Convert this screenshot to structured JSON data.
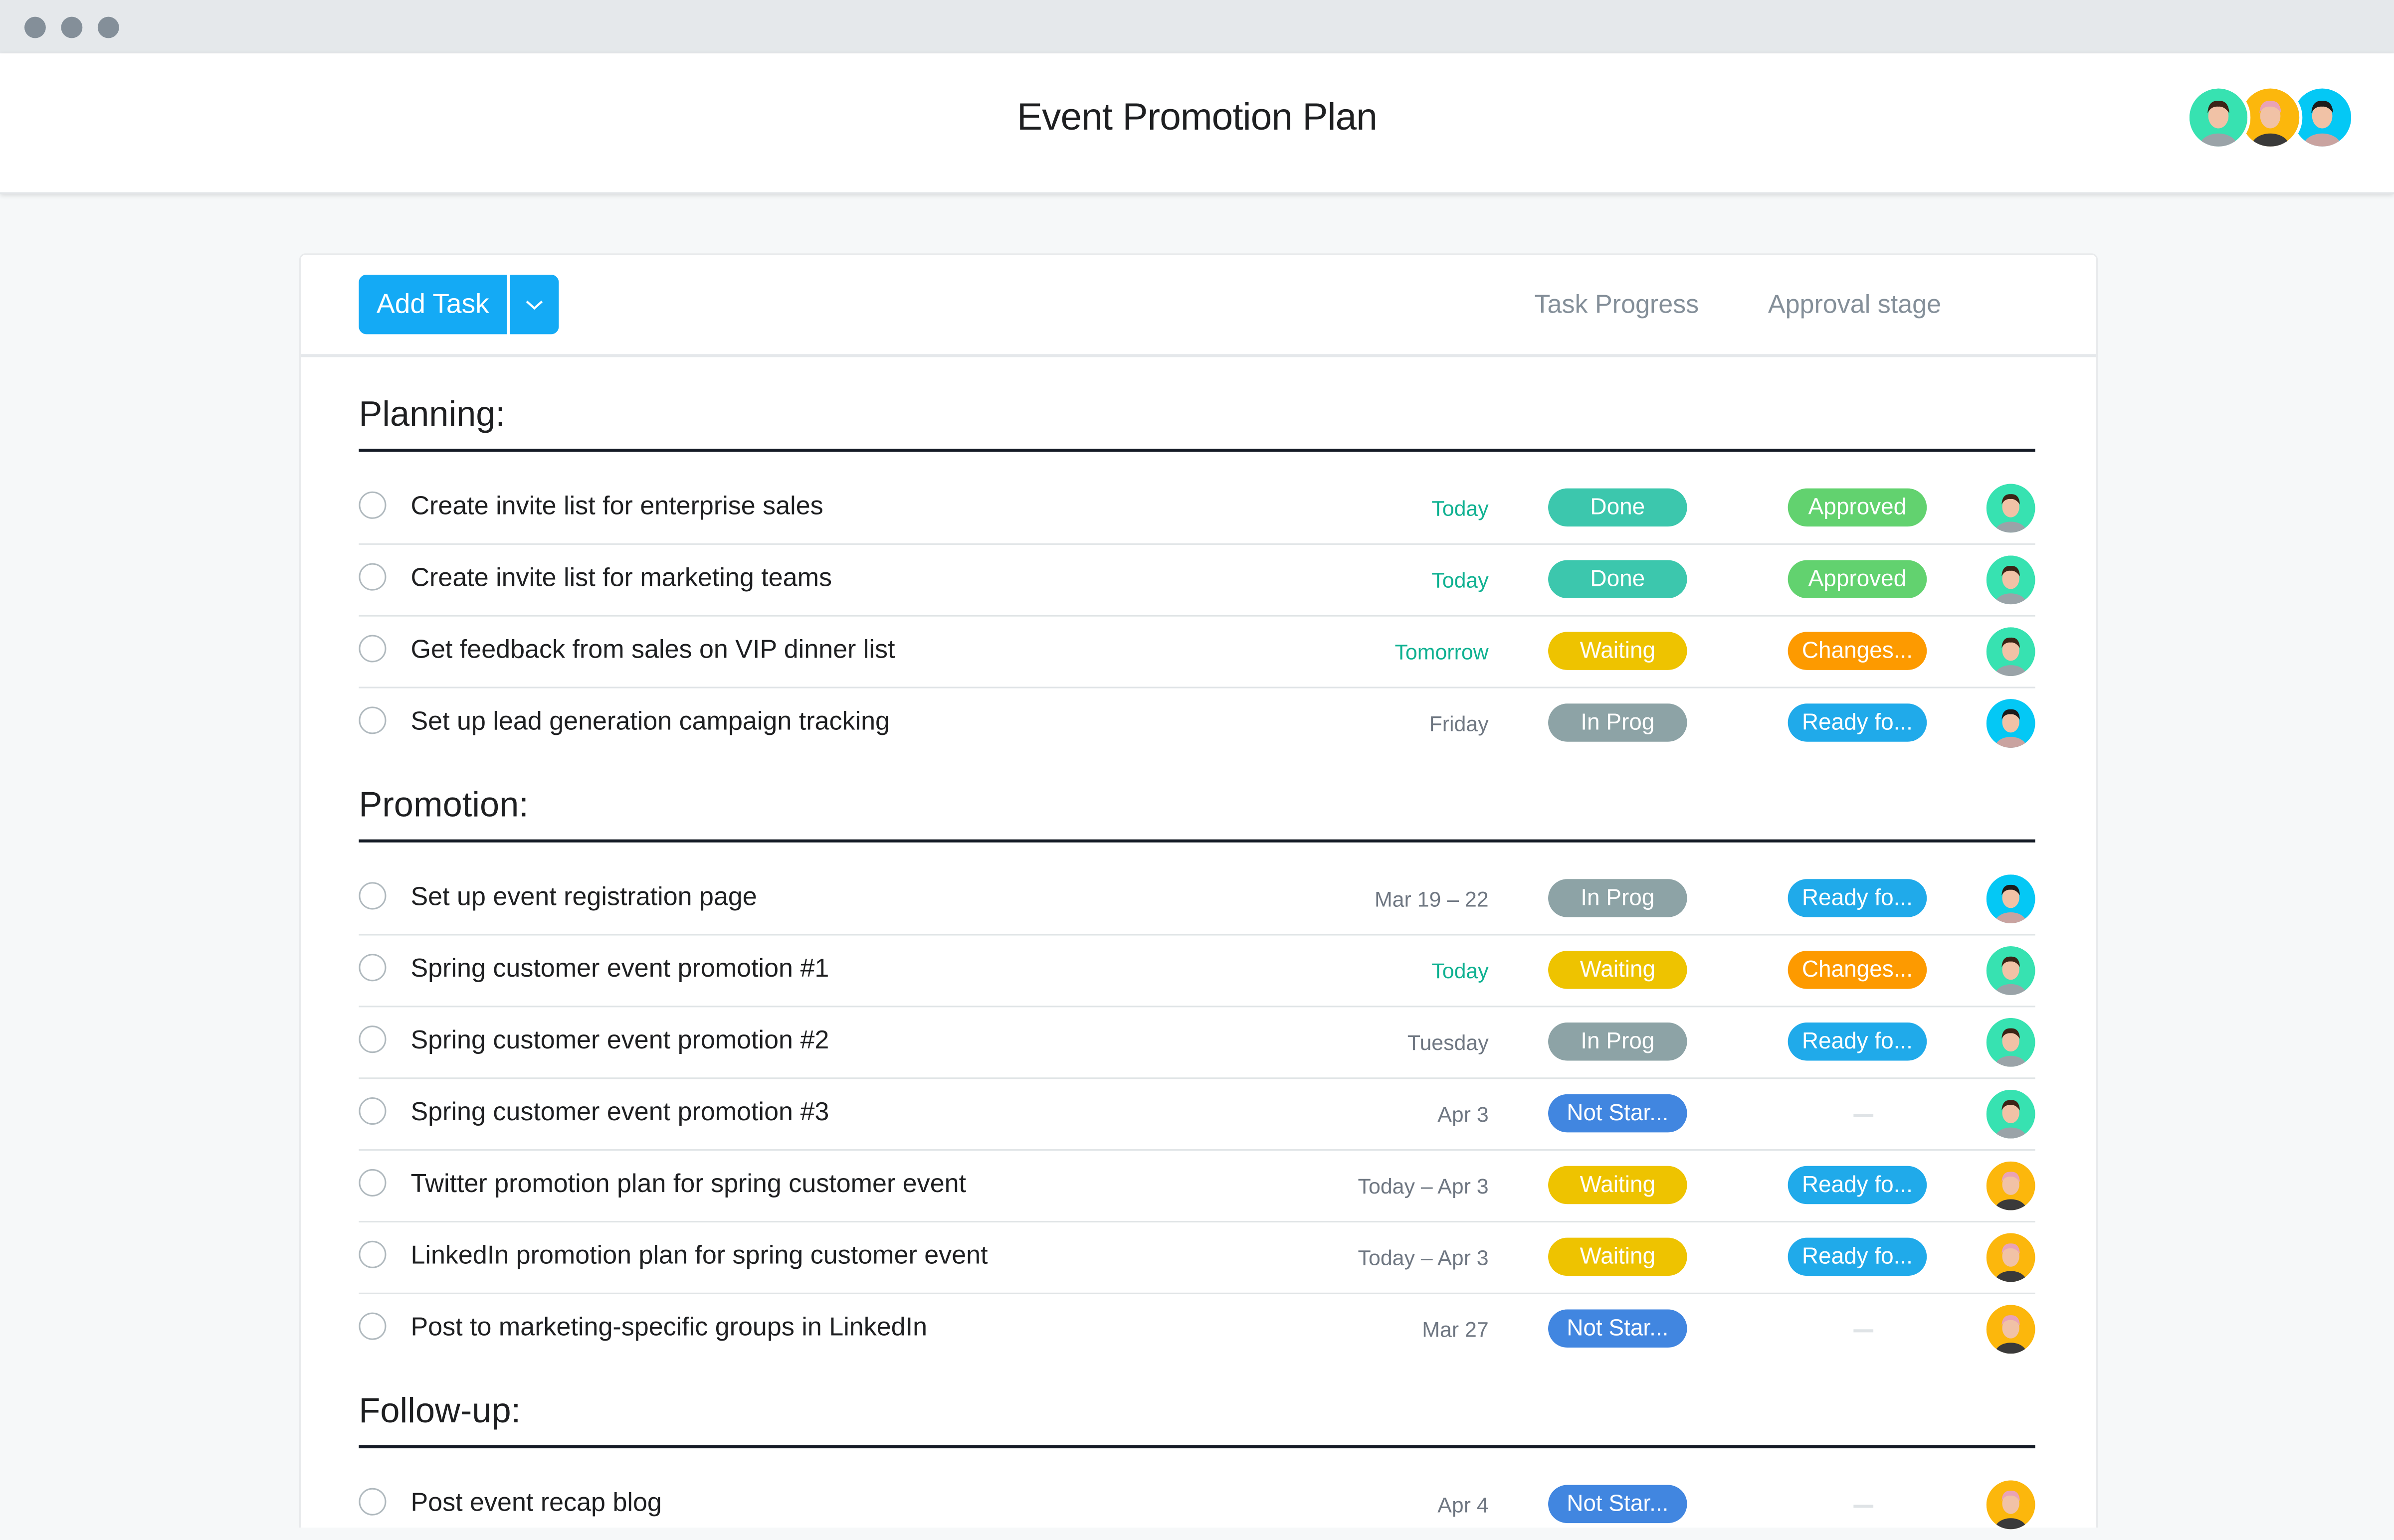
{
  "window": {
    "controls": [
      "close",
      "minimize",
      "maximize"
    ]
  },
  "header": {
    "title": "Event Promotion Plan",
    "members": [
      {
        "name": "member-1",
        "color": "#37e2b1"
      },
      {
        "name": "member-2",
        "color": "#fcb70c"
      },
      {
        "name": "member-3",
        "color": "#04c8f5"
      }
    ]
  },
  "toolbar": {
    "add_task_label": "Add Task",
    "dropdown_icon": "chevron-down-icon",
    "columns": {
      "progress": "Task Progress",
      "approval": "Approval stage"
    }
  },
  "colors": {
    "accent": "#14aaf5",
    "Done": "#3cc7ad",
    "Approved": "#62d26f",
    "Waiting": "#eec300",
    "Changes": "#fd9a00",
    "InProg": "#8da3a6",
    "Ready": "#20aaea",
    "NotStarted": "#4186e0",
    "due_soon": "#0fb191",
    "due_normal": "#6f7782"
  },
  "sections": [
    {
      "title": "Planning:",
      "tasks": [
        {
          "name": "Create invite list for enterprise sales",
          "due": "Today",
          "due_soon": true,
          "progress": "Done",
          "progress_key": "Done",
          "approval": "Approved",
          "approval_key": "Approved",
          "assignee": 0
        },
        {
          "name": "Create invite list for marketing teams",
          "due": "Today",
          "due_soon": true,
          "progress": "Done",
          "progress_key": "Done",
          "approval": "Approved",
          "approval_key": "Approved",
          "assignee": 0
        },
        {
          "name": "Get feedback from sales on VIP dinner list",
          "due": "Tomorrow",
          "due_soon": true,
          "progress": "Waiting",
          "progress_key": "Waiting",
          "approval": "Changes...",
          "approval_key": "Changes",
          "assignee": 0
        },
        {
          "name": "Set up lead generation campaign tracking",
          "due": "Friday",
          "due_soon": false,
          "progress": "In Prog",
          "progress_key": "InProg",
          "approval": "Ready fo...",
          "approval_key": "Ready",
          "assignee": 2
        }
      ]
    },
    {
      "title": "Promotion:",
      "tasks": [
        {
          "name": "Set up event registration page",
          "due": "Mar 19 – 22",
          "due_soon": false,
          "progress": "In Prog",
          "progress_key": "InProg",
          "approval": "Ready fo...",
          "approval_key": "Ready",
          "assignee": 2
        },
        {
          "name": "Spring customer event promotion #1",
          "due": "Today",
          "due_soon": true,
          "progress": "Waiting",
          "progress_key": "Waiting",
          "approval": "Changes...",
          "approval_key": "Changes",
          "assignee": 0
        },
        {
          "name": "Spring customer event promotion #2",
          "due": "Tuesday",
          "due_soon": false,
          "progress": "In Prog",
          "progress_key": "InProg",
          "approval": "Ready fo...",
          "approval_key": "Ready",
          "assignee": 0
        },
        {
          "name": "Spring customer event promotion #3",
          "due": "Apr 3",
          "due_soon": false,
          "progress": "Not Star...",
          "progress_key": "NotStarted",
          "approval": null,
          "approval_key": null,
          "assignee": 0
        },
        {
          "name": "Twitter promotion plan for spring customer event",
          "due": "Today – Apr 3",
          "due_soon": false,
          "progress": "Waiting",
          "progress_key": "Waiting",
          "approval": "Ready fo...",
          "approval_key": "Ready",
          "assignee": 1
        },
        {
          "name": "LinkedIn promotion plan for spring customer event",
          "due": "Today – Apr 3",
          "due_soon": false,
          "progress": "Waiting",
          "progress_key": "Waiting",
          "approval": "Ready fo...",
          "approval_key": "Ready",
          "assignee": 1
        },
        {
          "name": "Post to marketing-specific groups in LinkedIn",
          "due": "Mar 27",
          "due_soon": false,
          "progress": "Not Star...",
          "progress_key": "NotStarted",
          "approval": null,
          "approval_key": null,
          "assignee": 1
        }
      ]
    },
    {
      "title": "Follow-up:",
      "tasks": [
        {
          "name": "Post event recap blog",
          "due": "Apr 4",
          "due_soon": false,
          "progress": "Not Star...",
          "progress_key": "NotStarted",
          "approval": null,
          "approval_key": null,
          "assignee": 1
        }
      ]
    }
  ]
}
